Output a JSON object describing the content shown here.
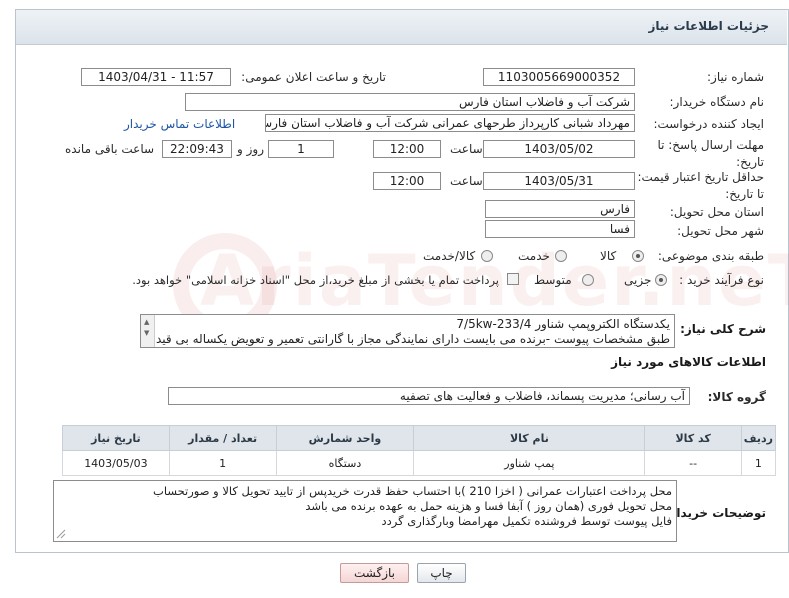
{
  "header": {
    "title": "جزئیات اطلاعات نیاز"
  },
  "form": {
    "need_number_label": "شماره نیاز:",
    "need_number": "1103005669000352",
    "announce_label": "تاریخ و ساعت اعلان عمومی:",
    "announce_value": "1403/04/31 - 11:57",
    "buyer_label": "نام دستگاه خریدار:",
    "buyer_value": "شرکت آب و فاضلاب استان فارس",
    "creator_label": "ایجاد کننده درخواست:",
    "creator_value": "مهرداد شبانی کارپرداز طرحهای عمرانی  شرکت آب و فاضلاب استان فارس",
    "contact_link": "اطلاعات تماس خریدار",
    "deadline_label": "مهلت ارسال پاسخ: تا تاریخ:",
    "deadline_date": "1403/05/02",
    "time_label": "ساعت",
    "deadline_time": "12:00",
    "days_value": "1",
    "days_label": "روز و",
    "remaining_time": "22:09:43",
    "remaining_label": "ساعت باقی مانده",
    "validity_label": "حداقل تاریخ اعتبار قیمت: تا تاریخ:",
    "validity_date": "1403/05/31",
    "validity_time": "12:00",
    "province_label": "استان محل تحویل:",
    "province_value": "فارس",
    "city_label": "شهر محل تحویل:",
    "city_value": "فسا",
    "category_label": "طبقه بندی موضوعی:",
    "category_options": [
      "کالا",
      "خدمت",
      "کالا/خدمت"
    ],
    "category_selected": "کالا",
    "process_label": "نوع فرآیند خرید :",
    "process_options": [
      "جزیی",
      "متوسط"
    ],
    "process_selected": "جزیی",
    "payment_note": "پرداخت تمام یا بخشی از مبلغ خرید،از محل \"اسناد خزانه اسلامی\" خواهد بود."
  },
  "description": {
    "label": "شرح کلی نیاز:",
    "line1": "یکدستگاه الکتروپمپ شناور 7/5kw-233/4",
    "line2": "طبق مشخصات پیوست -برنده می بایست دارای نمایندگی مجاز با گارانتی تعمیر و تعویض یکساله بی قید و"
  },
  "goods": {
    "section_title": "اطلاعات کالاهای مورد نیاز",
    "group_label": "گروه کالا:",
    "group_value": "آب رسانی؛ مدیریت پسماند، فاضلاب و فعالیت های تصفیه",
    "columns": [
      "ردیف",
      "کد کالا",
      "نام کالا",
      "واحد شمارش",
      "تعداد / مقدار",
      "تاریخ نیاز"
    ],
    "rows": [
      {
        "row": "1",
        "code": "--",
        "name": "پمپ شناور",
        "unit": "دستگاه",
        "qty": "1",
        "date": "1403/05/03"
      }
    ]
  },
  "buyer_notes": {
    "label": "توضیحات خریدار:",
    "line1": "محل پرداخت اعتبارات عمرانی ( اخزا  210 )با احتساب حفظ قدرت خریدپس از تایید تحویل کالا و صورتحساب",
    "line2": "محل تحویل فوری (همان روز ) آبفا فسا و هزینه حمل به عهده برنده می باشد",
    "line3": "فایل پیوست توسط فروشنده تکمیل مهرامضا وبارگذاری گردد"
  },
  "buttons": {
    "print": "چاپ",
    "back": "بازگشت"
  }
}
